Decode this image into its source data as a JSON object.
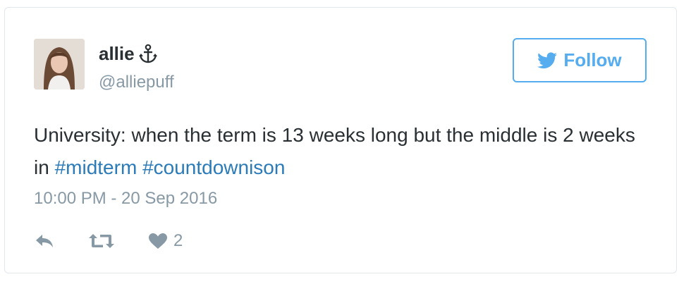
{
  "tweet": {
    "author": {
      "display_name": "allie",
      "handle": "@alliepuff",
      "avatar_icon": "profile-photo",
      "name_emoji_icon": "anchor-icon"
    },
    "follow_button": {
      "label": "Follow",
      "icon": "twitter-bird-icon"
    },
    "text": {
      "prefix": "University: when the term is 13 weeks long but the middle is 2 weeks in ",
      "hashtags": [
        "#midterm",
        "#countdownison"
      ]
    },
    "timestamp": "10:00 PM - 20 Sep 2016",
    "actions": {
      "reply_icon": "reply-icon",
      "retweet_icon": "retweet-icon",
      "like_icon": "heart-icon",
      "like_count": "2"
    }
  },
  "colors": {
    "text": "#292f33",
    "muted": "#8899a6",
    "link": "#2b7bb9",
    "brand": "#55acee",
    "border": "#e1e8ed"
  }
}
